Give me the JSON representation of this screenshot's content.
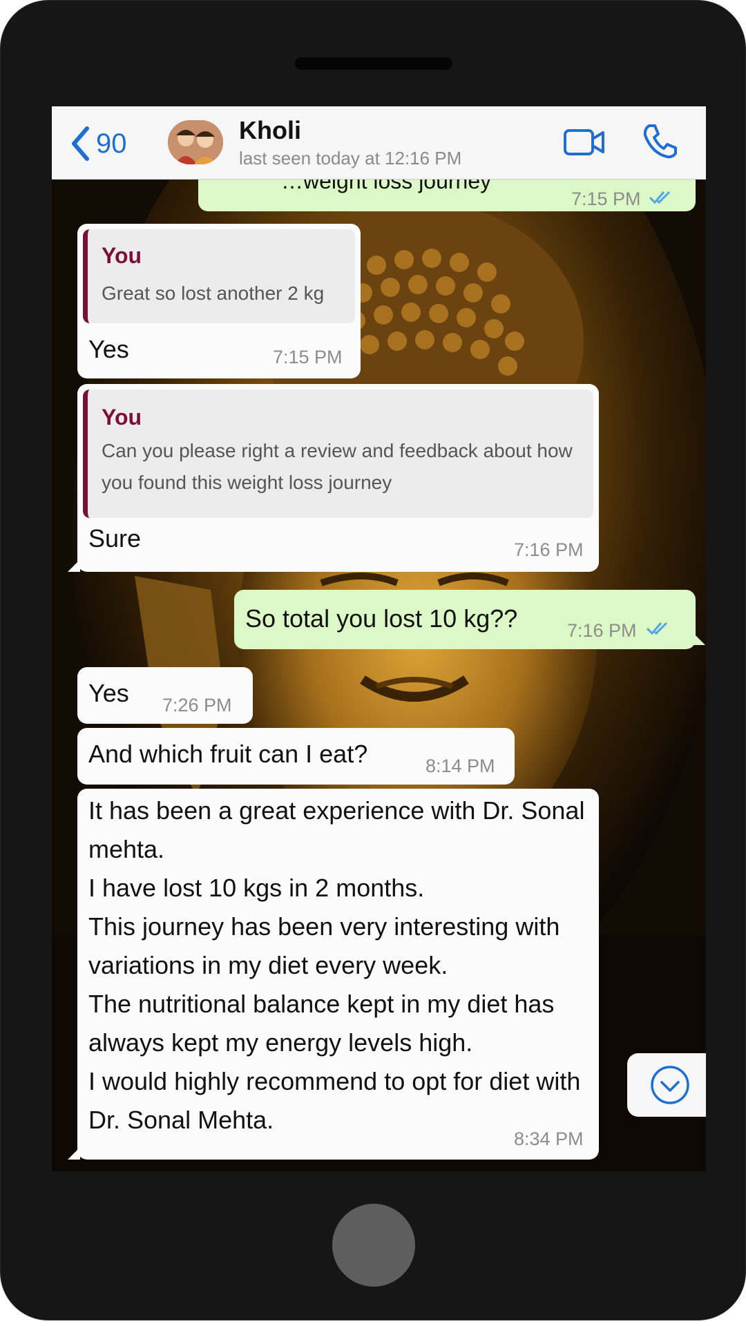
{
  "header": {
    "back_count": "90",
    "contact_name": "Kholi",
    "last_seen": "last seen today at 12:16 PM"
  },
  "messages": [
    {
      "direction": "out",
      "text": "…weight loss journey",
      "time": "7:15 PM",
      "status": "read"
    },
    {
      "direction": "in",
      "quote_author": "You",
      "quote_text": "Great so lost another 2 kg",
      "text": "Yes",
      "time": "7:15 PM"
    },
    {
      "direction": "in",
      "quote_author": "You",
      "quote_text": "Can you please right a review and feedback about how you found this weight loss journey",
      "text": "Sure",
      "time": "7:16 PM"
    },
    {
      "direction": "out",
      "text": "So total you lost 10 kg??",
      "time": "7:16 PM",
      "status": "read"
    },
    {
      "direction": "in",
      "text": "Yes",
      "time": "7:26 PM"
    },
    {
      "direction": "in",
      "text": "And which fruit can I eat?",
      "time": "8:14 PM"
    },
    {
      "direction": "in",
      "text": "It has been a great experience with Dr. Sonal mehta.\nI have lost 10 kgs in 2 months.\nThis journey has been very interesting with variations in my diet every week.\nThe nutritional balance kept in my diet has always kept my energy levels high.\nI would highly recommend to opt for diet with Dr. Sonal Mehta.",
      "time": "8:34 PM"
    }
  ],
  "icons": {
    "back": "chevron-left-icon",
    "video": "video-camera-icon",
    "call": "phone-icon",
    "scroll": "chevron-down-circle-icon",
    "read": "double-check-icon"
  },
  "colors": {
    "incoming_bubble": "#fbfbfb",
    "outgoing_bubble": "#dcf8c6",
    "quote_accent": "#7a0f3a",
    "ios_blue": "#1f6fd1",
    "read_ticks": "#4fa3e6"
  }
}
